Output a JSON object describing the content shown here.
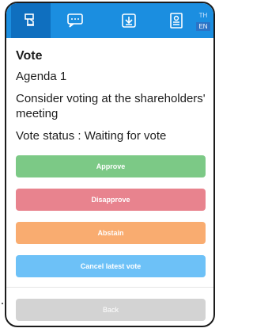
{
  "tabs": [
    {
      "icon": "hand-vote-icon",
      "active": true
    },
    {
      "icon": "chat-bubble-icon",
      "active": false
    },
    {
      "icon": "download-icon",
      "active": false
    },
    {
      "icon": "profile-card-icon",
      "active": false
    }
  ],
  "language": {
    "th": "TH",
    "en": "EN"
  },
  "vote": {
    "title": "Vote",
    "agenda": "Agenda 1",
    "question": "Consider voting at the shareholders' meeting",
    "status": "Vote status : Waiting for vote"
  },
  "buttons": {
    "approve": "Approve",
    "disapprove": "Disapprove",
    "abstain": "Abstain",
    "cancel": "Cancel latest vote",
    "back": "Back"
  },
  "colors": {
    "topbar": "#1b8ee0",
    "approve": "#7cc986",
    "disapprove": "#e8838e",
    "abstain": "#f9ac70",
    "cancel": "#6dc1f7",
    "back": "#d3d3d3"
  }
}
